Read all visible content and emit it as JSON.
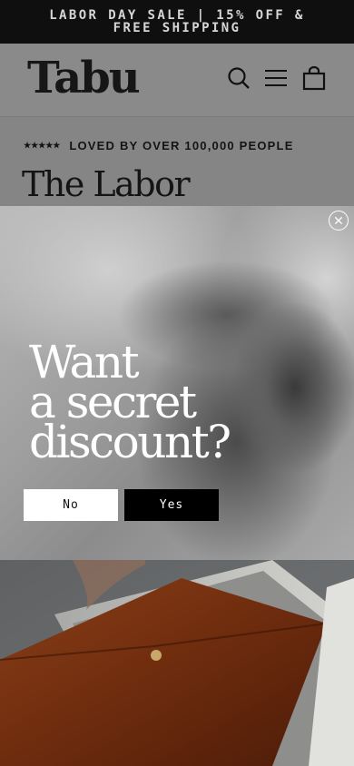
{
  "announcement": {
    "line1": "LABOR DAY SALE | 15% OFF &",
    "line2": "FREE SHIPPING"
  },
  "header": {
    "logo": "Tabu",
    "icons": [
      "search-icon",
      "menu-icon",
      "cart-icon"
    ]
  },
  "content": {
    "rating_stars": "★★★★★",
    "loved_text": "LOVED BY OVER 100,000 PEOPLE",
    "product_title": "The Labor"
  },
  "popup": {
    "headline": [
      "Want",
      "a secret",
      "discount?"
    ],
    "no_label": "No",
    "yes_label": "Yes"
  },
  "colors": {
    "announcement_bg": "#0f0f0f",
    "overlay_gray": "#8a8a8a",
    "leather_brown": "#7a3413"
  }
}
